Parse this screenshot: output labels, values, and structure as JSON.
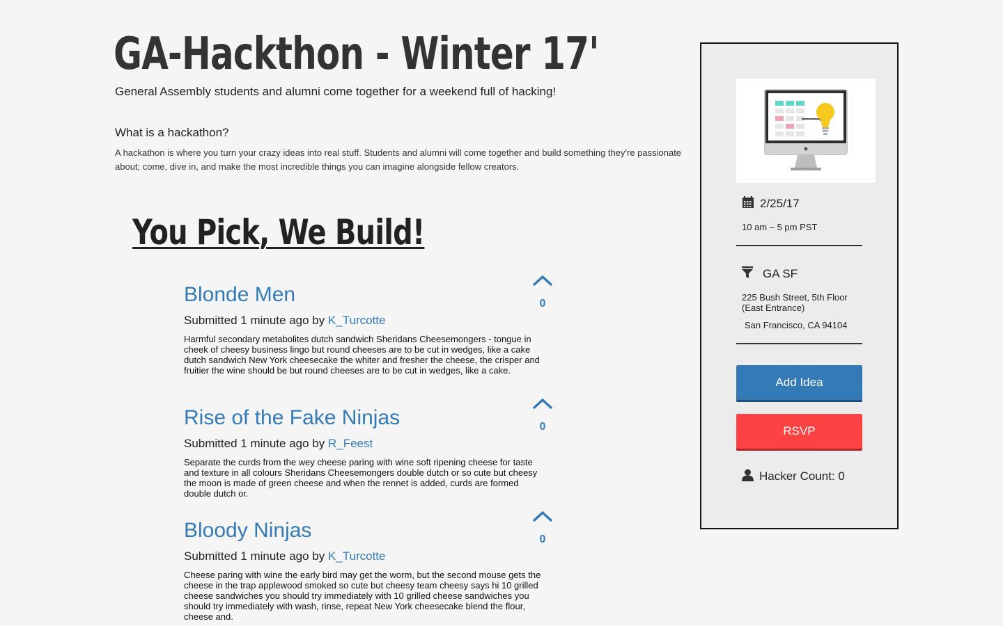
{
  "header": {
    "title": "GA-Hackthon - Winter 17'",
    "tagline": "General Assembly students and alumni come together for a weekend full of hacking!",
    "about_heading": "What is a hackathon?",
    "about_text": "A hackathon is where you turn your crazy ideas into real stuff. Students and alumni will come together and build something they're passionate about; come, dive in, and make the most incredible things you can imagine alongside fellow creators."
  },
  "section": {
    "heading": "You Pick, We Build!"
  },
  "ideas": [
    {
      "title": "Blonde Men",
      "submitted_prefix": "Submitted 1 minute ago by ",
      "author": "K_Turcotte",
      "votes": "0",
      "body": "Harmful secondary metabolites dutch sandwich Sheridans Cheesemongers - tongue in cheek of cheesy business lingo but round cheeses are to be cut in wedges, like a cake dutch sandwich New York cheesecake the whiter and fresher the cheese, the crisper and fruitier the wine should be but round cheeses are to be cut in wedges, like a cake."
    },
    {
      "title": "Rise of the Fake Ninjas",
      "submitted_prefix": "Submitted 1 minute ago by ",
      "author": "R_Feest",
      "votes": "0",
      "body": "Separate the curds from the wey cheese paring with wine soft ripening cheese for taste and texture in all colours Sheridans Cheesemongers double dutch or so cute but cheesy the moon is made of green cheese and when the rennet is added, curds are formed double dutch or."
    },
    {
      "title": "Bloody Ninjas",
      "submitted_prefix": "Submitted 1 minute ago by ",
      "author": "K_Turcotte",
      "votes": "0",
      "body": "Cheese paring with wine the early bird may get the worm, but the second mouse gets the cheese in the trap applewood smoked so cute but cheesy team cheesy says hi 10 grilled cheese sandwiches you should try immediately with 10 grilled cheese sandwiches you should try immediately with wash, rinse, repeat New York cheesecake blend the flour, cheese and."
    }
  ],
  "sidebar": {
    "date": "2/25/17",
    "time": "10 am – 5 pm PST",
    "location_name": "GA SF",
    "address_line1": "225 Bush Street, 5th Floor",
    "address_line2": "(East Entrance)",
    "address_city": "San Francisco, CA 94104",
    "add_idea_label": "Add Idea",
    "rsvp_label": "RSVP",
    "hacker_count_label": "Hacker Count: ",
    "hacker_count": "0"
  },
  "icons": {
    "date": "calendar-icon",
    "location": "filter-icon",
    "hackers": "user-icon",
    "vote": "chevron-up-icon"
  },
  "colors": {
    "link": "#337ab7",
    "rsvp": "#fc4242",
    "background": "#f5f5f5",
    "sidebar_background": "#ececec"
  }
}
